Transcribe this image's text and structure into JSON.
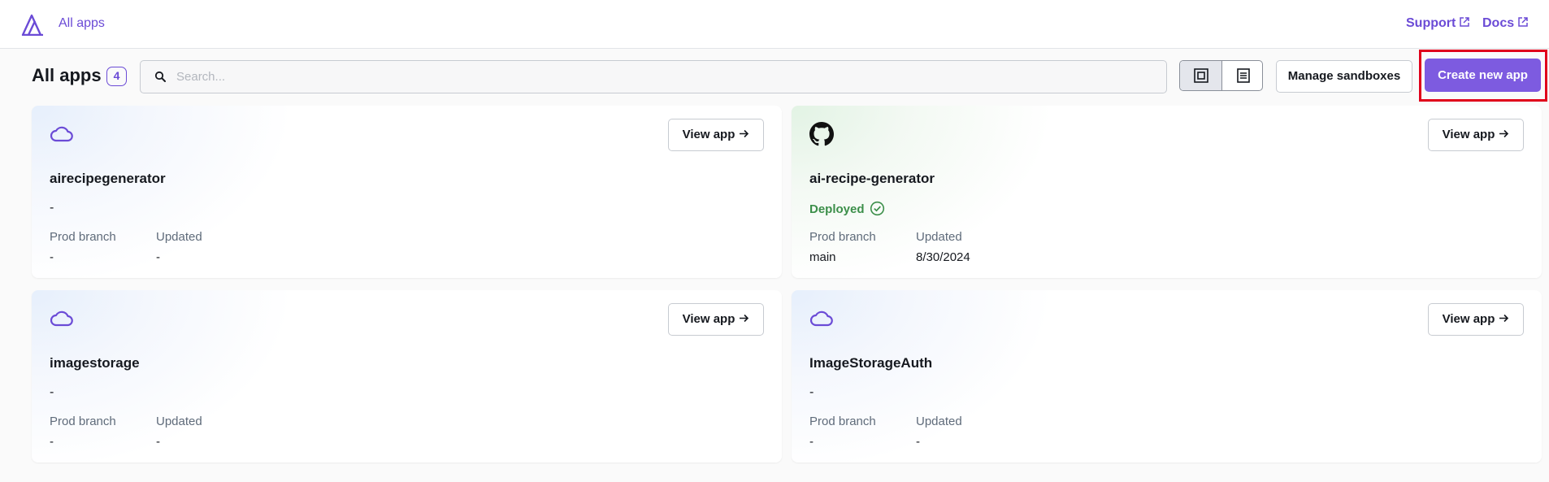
{
  "nav": {
    "all_apps_link": "All apps",
    "support_link": "Support",
    "docs_link": "Docs"
  },
  "header": {
    "title": "All apps",
    "count": "4",
    "search_placeholder": "Search...",
    "search_value": "",
    "manage_sandboxes_label": "Manage sandboxes",
    "create_app_label": "Create new app"
  },
  "cards": [
    {
      "name": "airecipegenerator",
      "icon": "cloud-icon",
      "status": "-",
      "view_label": "View app",
      "prod_branch_label": "Prod branch",
      "prod_branch": "-",
      "updated_label": "Updated",
      "updated": "-"
    },
    {
      "name": "ai-recipe-generator",
      "icon": "github-icon",
      "status": "Deployed",
      "view_label": "View app",
      "prod_branch_label": "Prod branch",
      "prod_branch": "main",
      "updated_label": "Updated",
      "updated": "8/30/2024"
    },
    {
      "name": "imagestorage",
      "icon": "cloud-icon",
      "status": "-",
      "view_label": "View app",
      "prod_branch_label": "Prod branch",
      "prod_branch": "-",
      "updated_label": "Updated",
      "updated": "-"
    },
    {
      "name": "ImageStorageAuth",
      "icon": "cloud-icon",
      "status": "-",
      "view_label": "View app",
      "prod_branch_label": "Prod branch",
      "prod_branch": "-",
      "updated_label": "Updated",
      "updated": "-"
    }
  ],
  "colors": {
    "accent": "#7d5be0",
    "link": "#6b4bd6",
    "deployed": "#3c8f4a",
    "highlight_box": "#e0001b"
  }
}
